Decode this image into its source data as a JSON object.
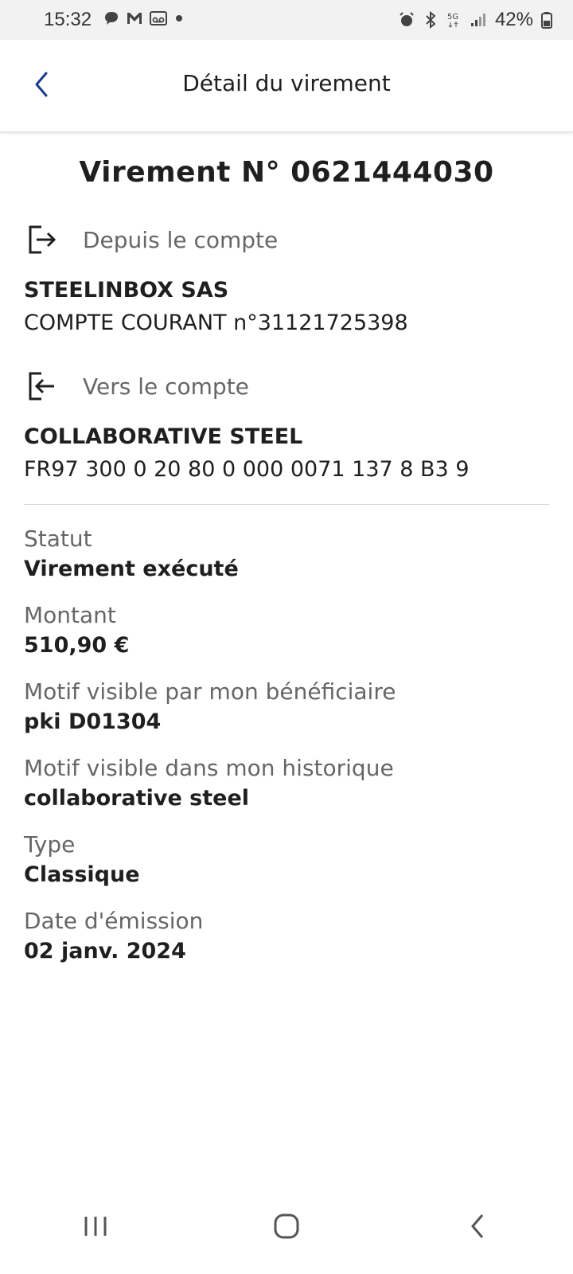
{
  "status_bar": {
    "time": "15:32",
    "battery_pct": "42%",
    "icons_left": [
      "chat-icon",
      "gmail-icon",
      "voicemail-icon",
      "dot-icon"
    ],
    "icons_right": [
      "alarm-icon",
      "bluetooth-icon",
      "5g-icon",
      "signal-icon",
      "battery-icon"
    ]
  },
  "header": {
    "title": "Détail du virement"
  },
  "transfer": {
    "title": "Virement N° 0621444030"
  },
  "from_account": {
    "header": "Depuis le compte",
    "name": "STEELINBOX SAS",
    "number": "COMPTE COURANT n°31121725398"
  },
  "to_account": {
    "header": "Vers le compte",
    "name": "COLLABORATIVE STEEL",
    "number": "FR97  300 0 20 80 0 000  0071  137 8 B3 9"
  },
  "details": [
    {
      "label": "Statut",
      "value": "Virement exécuté"
    },
    {
      "label": "Montant",
      "value": "510,90 €"
    },
    {
      "label": "Motif visible par mon bénéficiaire",
      "value": "pki D01304"
    },
    {
      "label": "Motif visible dans mon historique",
      "value": "collaborative steel"
    },
    {
      "label": "Type",
      "value": "Classique"
    },
    {
      "label": "Date d'émission",
      "value": "02 janv. 2024"
    }
  ],
  "colors": {
    "accent": "#1b3a8c",
    "text": "#1f1f1f",
    "muted": "#666666"
  }
}
